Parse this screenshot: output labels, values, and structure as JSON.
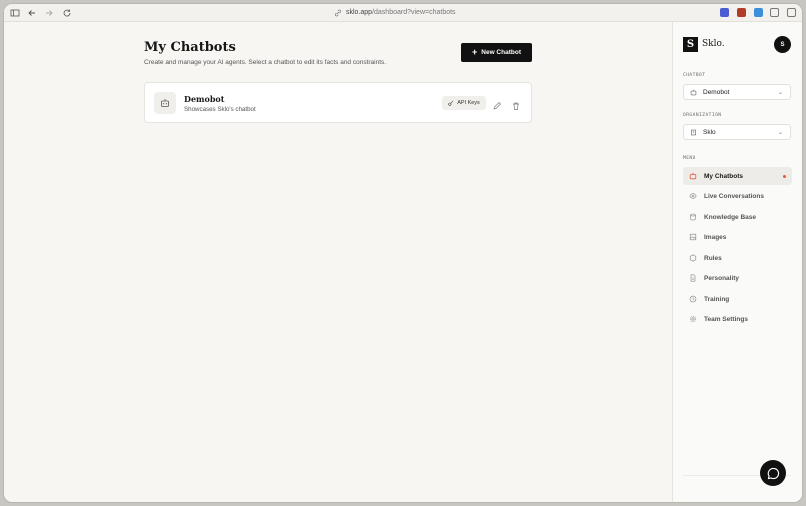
{
  "browser": {
    "url_host": "sklo.app",
    "url_path": "/dashboard?view=chatbots"
  },
  "main": {
    "title": "My Chatbots",
    "subtitle": "Create and manage your AI agents. Select a chatbot to edit its facts and constraints.",
    "new_button_label": "New Chatbot",
    "chatbots": [
      {
        "name": "Demobot",
        "description": "Showcases Sklo's chatbot",
        "api_keys_label": "API Keys"
      }
    ]
  },
  "sidebar": {
    "logo_mark": "S",
    "logo_text": "Sklo.",
    "user_initial": "S",
    "chatbot_label": "CHATBOT",
    "chatbot_value": "Demobot",
    "organization_label": "ORGANIZATION",
    "organization_value": "Sklo",
    "menu_label": "MENU",
    "items": [
      {
        "label": "My Chatbots",
        "icon": "robot-icon",
        "active": true
      },
      {
        "label": "Live Conversations",
        "icon": "eye-icon",
        "active": false
      },
      {
        "label": "Knowledge Base",
        "icon": "database-icon",
        "active": false
      },
      {
        "label": "Images",
        "icon": "image-icon",
        "active": false
      },
      {
        "label": "Rules",
        "icon": "hexagon-icon",
        "active": false
      },
      {
        "label": "Personality",
        "icon": "document-icon",
        "active": false
      },
      {
        "label": "Training",
        "icon": "clock-icon",
        "active": false
      },
      {
        "label": "Team Settings",
        "icon": "gear-icon",
        "active": false
      }
    ]
  },
  "colors": {
    "accent_dot": "#e8593a",
    "primary_button": "#111111"
  }
}
